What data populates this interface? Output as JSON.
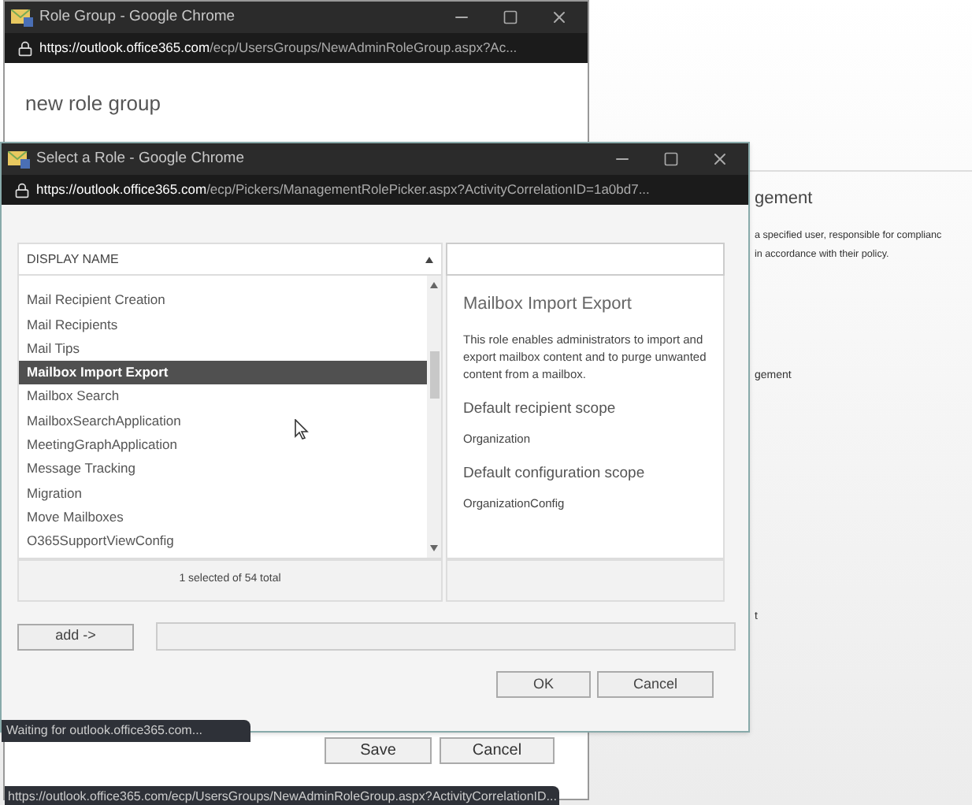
{
  "background_page": {
    "heading": "gement",
    "text_lines": [
      "a specified user, responsible for complianc",
      "in accordance with their policy."
    ],
    "fragments": [
      "gement",
      "t"
    ]
  },
  "role_group_window": {
    "title": "Role Group - Google Chrome",
    "url_host": "https://outlook.office365.com",
    "url_path": "/ecp/UsersGroups/NewAdminRoleGroup.aspx?Ac...",
    "heading": "new role group",
    "buttons": [
      "Save",
      "Cancel"
    ],
    "status": "https://outlook.office365.com/ecp/UsersGroups/NewAdminRoleGroup.aspx?ActivityCorrelationID..."
  },
  "select_role_window": {
    "title": "Select a Role - Google Chrome",
    "url_host": "https://outlook.office365.com",
    "url_path": "/ecp/Pickers/ManagementRolePicker.aspx?ActivityCorrelationID=1a0bd7...",
    "column": "DISPLAY NAME",
    "roles": [
      {
        "name": "Mail Recipient Creation",
        "selected": false
      },
      {
        "name": "Mail Recipients",
        "selected": false
      },
      {
        "name": "Mail Tips",
        "selected": false
      },
      {
        "name": "Mailbox Import Export",
        "selected": true
      },
      {
        "name": "Mailbox Search",
        "selected": false
      },
      {
        "name": "MailboxSearchApplication",
        "selected": false
      },
      {
        "name": "MeetingGraphApplication",
        "selected": false
      },
      {
        "name": "Message Tracking",
        "selected": false
      },
      {
        "name": "Migration",
        "selected": false
      },
      {
        "name": "Move Mailboxes",
        "selected": false
      },
      {
        "name": "O365SupportViewConfig",
        "selected": false
      }
    ],
    "details": {
      "title": "Mailbox Import Export",
      "description": "This role enables administrators to import and export mailbox content and to purge unwanted content from a mailbox.",
      "sections": [
        {
          "label": "Default recipient scope",
          "value": "Organization"
        },
        {
          "label": "Default configuration scope",
          "value": "OrganizationConfig"
        }
      ]
    },
    "count": "1 selected of 54 total",
    "add_button": "add ->",
    "buttons": [
      "OK",
      "Cancel"
    ],
    "status": "Waiting for outlook.office365.com..."
  }
}
